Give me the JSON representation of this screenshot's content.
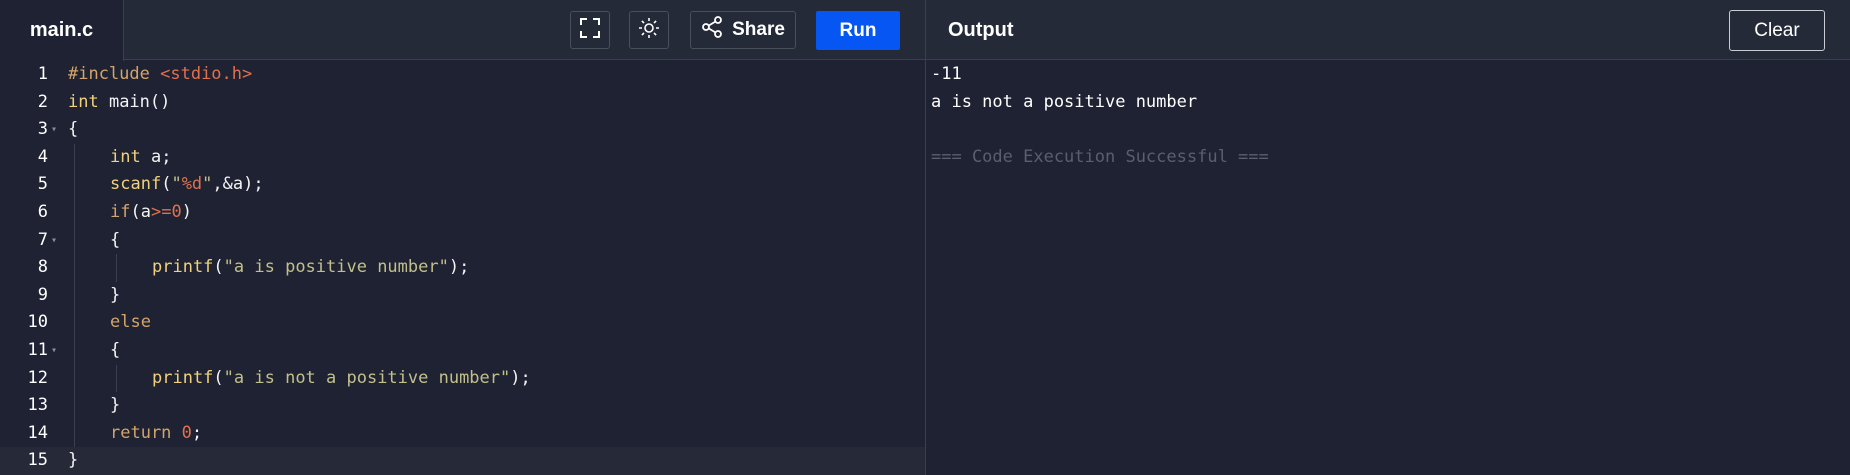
{
  "header": {
    "file_tab": "main.c",
    "share_label": "Share",
    "run_label": "Run",
    "output_title": "Output",
    "clear_label": "Clear"
  },
  "editor": {
    "active_line": 15,
    "lines": [
      {
        "n": "1",
        "fold": false,
        "indent": 0,
        "tokens": [
          {
            "t": "#include ",
            "c": "pre"
          },
          {
            "t": "<stdio.h>",
            "c": "inc"
          }
        ]
      },
      {
        "n": "2",
        "fold": false,
        "indent": 0,
        "tokens": [
          {
            "t": "int",
            "c": "kw"
          },
          {
            "t": " main()",
            "c": ""
          }
        ]
      },
      {
        "n": "3",
        "fold": true,
        "indent": 0,
        "tokens": [
          {
            "t": "{",
            "c": ""
          }
        ]
      },
      {
        "n": "4",
        "fold": false,
        "indent": 1,
        "tokens": [
          {
            "t": "int",
            "c": "kw"
          },
          {
            "t": " a;",
            "c": ""
          }
        ]
      },
      {
        "n": "5",
        "fold": false,
        "indent": 1,
        "tokens": [
          {
            "t": "scanf",
            "c": "kw"
          },
          {
            "t": "(",
            "c": ""
          },
          {
            "t": "\"",
            "c": "str"
          },
          {
            "t": "%d",
            "c": "fmt"
          },
          {
            "t": "\"",
            "c": "str"
          },
          {
            "t": ",&a);",
            "c": ""
          }
        ]
      },
      {
        "n": "6",
        "fold": false,
        "indent": 1,
        "tokens": [
          {
            "t": "if",
            "c": "kw2"
          },
          {
            "t": "(a",
            "c": ""
          },
          {
            "t": ">=",
            "c": "op"
          },
          {
            "t": "0",
            "c": "num"
          },
          {
            "t": ")",
            "c": ""
          }
        ]
      },
      {
        "n": "7",
        "fold": true,
        "indent": 1,
        "tokens": [
          {
            "t": "{",
            "c": ""
          }
        ]
      },
      {
        "n": "8",
        "fold": false,
        "indent": 2,
        "tokens": [
          {
            "t": "printf",
            "c": "kw"
          },
          {
            "t": "(",
            "c": ""
          },
          {
            "t": "\"a is positive number\"",
            "c": "str"
          },
          {
            "t": ");",
            "c": ""
          }
        ]
      },
      {
        "n": "9",
        "fold": false,
        "indent": 1,
        "tokens": [
          {
            "t": "}",
            "c": ""
          }
        ]
      },
      {
        "n": "10",
        "fold": false,
        "indent": 1,
        "tokens": [
          {
            "t": "else",
            "c": "kw2"
          }
        ]
      },
      {
        "n": "11",
        "fold": true,
        "indent": 1,
        "tokens": [
          {
            "t": "{",
            "c": ""
          }
        ]
      },
      {
        "n": "12",
        "fold": false,
        "indent": 2,
        "tokens": [
          {
            "t": "printf",
            "c": "kw"
          },
          {
            "t": "(",
            "c": ""
          },
          {
            "t": "\"a is not a positive number\"",
            "c": "str"
          },
          {
            "t": ");",
            "c": ""
          }
        ]
      },
      {
        "n": "13",
        "fold": false,
        "indent": 1,
        "tokens": [
          {
            "t": "}",
            "c": ""
          }
        ]
      },
      {
        "n": "14",
        "fold": false,
        "indent": 1,
        "tokens": [
          {
            "t": "return",
            "c": "kw2"
          },
          {
            "t": " ",
            "c": ""
          },
          {
            "t": "0",
            "c": "num"
          },
          {
            "t": ";",
            "c": ""
          }
        ]
      },
      {
        "n": "15",
        "fold": false,
        "indent": 0,
        "tokens": [
          {
            "t": "}",
            "c": ""
          }
        ]
      }
    ]
  },
  "output": {
    "lines": [
      {
        "text": "-11",
        "muted": false
      },
      {
        "text": "a is not a positive number",
        "muted": false
      },
      {
        "text": "",
        "muted": false
      },
      {
        "text": "=== Code Execution Successful ===",
        "muted": true
      }
    ]
  },
  "icons": {
    "fullscreen": "fullscreen-icon",
    "theme": "sun-icon",
    "share": "share-icon",
    "fold": "fold-caret-icon"
  },
  "colors": {
    "background": "#1e2232",
    "topbar": "#252a38",
    "run_button": "#0556f3",
    "keyword": "#f1d27a",
    "string": "#c2c08a",
    "number": "#e0714f"
  }
}
